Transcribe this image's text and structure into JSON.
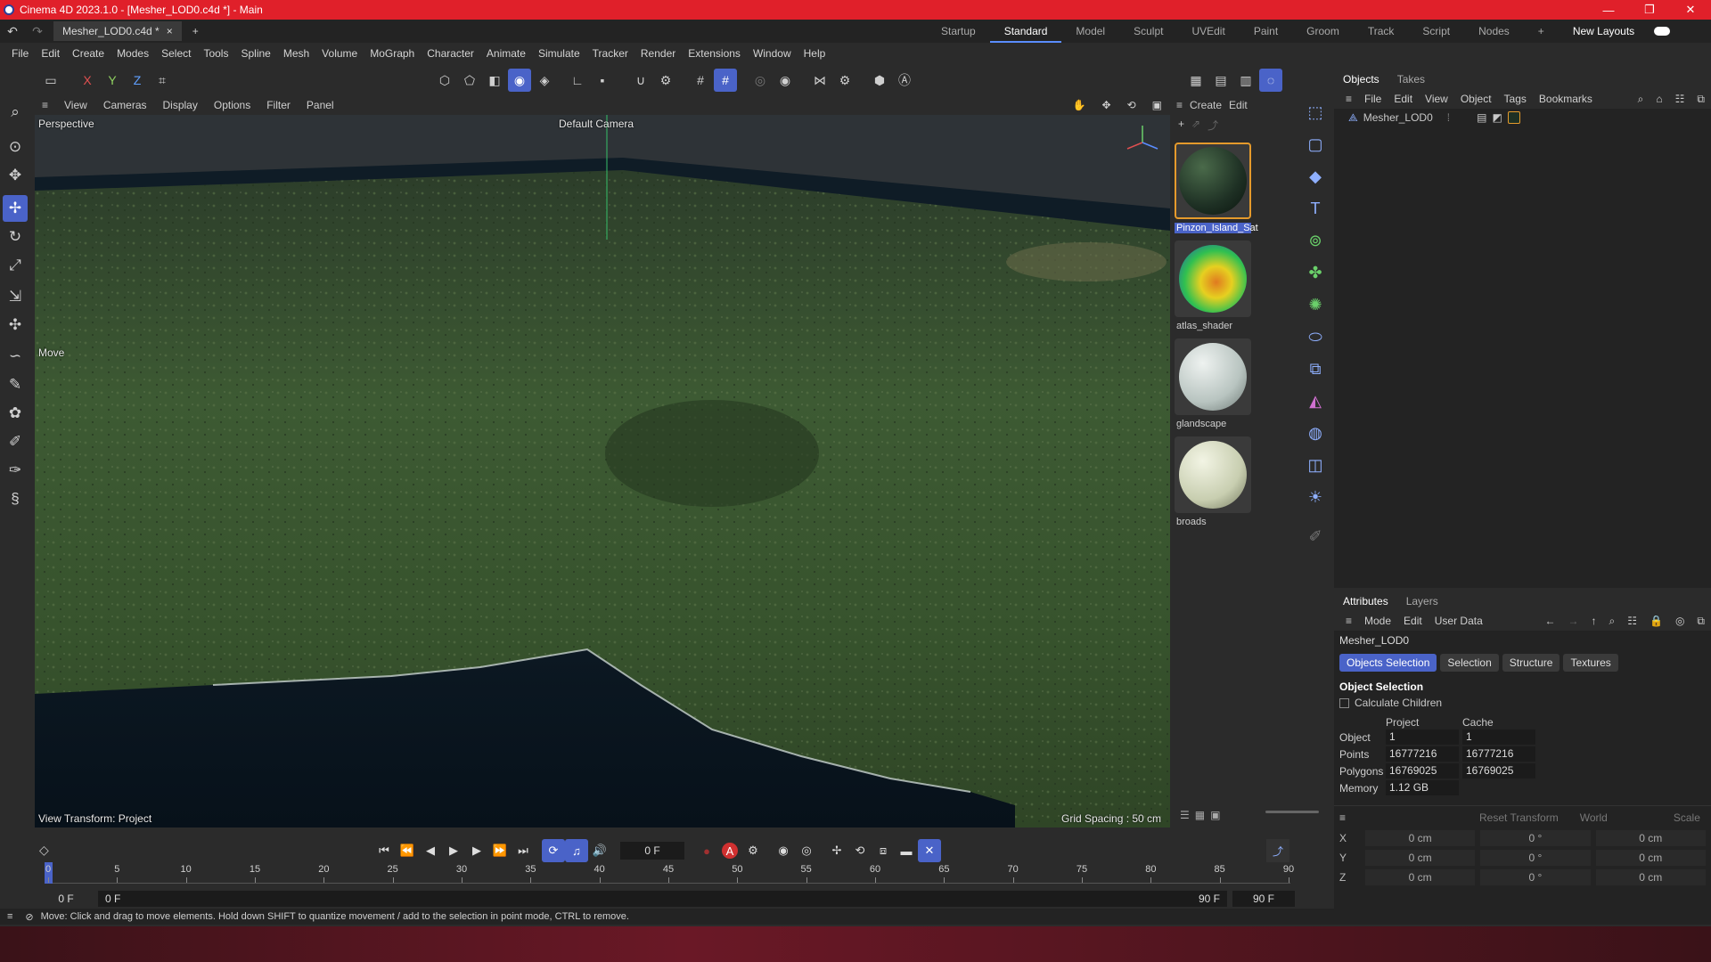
{
  "titlebar": {
    "title": "Cinema 4D 2023.1.0 - [Mesher_LOD0.c4d *] - Main",
    "min": "—",
    "max": "❐",
    "close": "✕"
  },
  "tabbar": {
    "doc_tab": "Mesher_LOD0.c4d *",
    "doc_close": "×",
    "add_tab": "+",
    "layouts": [
      "Startup",
      "Standard",
      "Model",
      "Sculpt",
      "UVEdit",
      "Paint",
      "Groom",
      "Track",
      "Script",
      "Nodes"
    ],
    "add_layout": "+",
    "new_layouts": "New Layouts"
  },
  "menubar": [
    "File",
    "Edit",
    "Create",
    "Modes",
    "Select",
    "Tools",
    "Spline",
    "Mesh",
    "Volume",
    "MoGraph",
    "Character",
    "Animate",
    "Simulate",
    "Tracker",
    "Render",
    "Extensions",
    "Window",
    "Help"
  ],
  "toolbar": {
    "x_label": "X",
    "y_label": "Y",
    "z_label": "Z"
  },
  "viewport_menu": [
    "View",
    "Cameras",
    "Display",
    "Options",
    "Filter",
    "Panel"
  ],
  "viewport": {
    "name": "Perspective",
    "camera": "Default Camera",
    "tool_label": "Move",
    "view_transform": "View Transform: Project",
    "grid_spacing": "Grid Spacing : 50 cm"
  },
  "material_menu": [
    "Create",
    "Edit"
  ],
  "materials": [
    {
      "name": "Pinzon_Island_Sat",
      "selected": true
    },
    {
      "name": "atlas_shader",
      "selected": false
    },
    {
      "name": "glandscape",
      "selected": false
    },
    {
      "name": "broads",
      "selected": false
    }
  ],
  "objects_panel": {
    "tabs": [
      "Objects",
      "Takes"
    ],
    "menu": [
      "File",
      "Edit",
      "View",
      "Object",
      "Tags",
      "Bookmarks"
    ],
    "item": "Mesher_LOD0"
  },
  "attributes_panel": {
    "tabs": [
      "Attributes",
      "Layers"
    ],
    "menu": [
      "Mode",
      "Edit",
      "User Data"
    ],
    "object_name": "Mesher_LOD0",
    "subtabs": [
      "Objects Selection",
      "Selection",
      "Structure",
      "Textures"
    ],
    "section_title": "Object Selection",
    "checkbox_label": "Calculate Children",
    "col_project": "Project",
    "col_cache": "Cache",
    "stats": [
      {
        "label": "Object",
        "project": "1",
        "cache": "1"
      },
      {
        "label": "Points",
        "project": "16777216",
        "cache": "16777216"
      },
      {
        "label": "Polygons",
        "project": "16769025",
        "cache": "16769025"
      },
      {
        "label": "Memory",
        "project": "1.12 GB",
        "cache": ""
      }
    ],
    "reset_transform": "Reset Transform",
    "world": "World",
    "scale": "Scale",
    "coords": [
      {
        "axis": "X",
        "pos": "0 cm",
        "rot": "0 °",
        "size": "0 cm"
      },
      {
        "axis": "Y",
        "pos": "0 cm",
        "rot": "0 °",
        "size": "0 cm"
      },
      {
        "axis": "Z",
        "pos": "0 cm",
        "rot": "0 °",
        "size": "0 cm"
      }
    ]
  },
  "timeline": {
    "current_frame": "0 F",
    "ruler_labels": [
      "0",
      "5",
      "10",
      "15",
      "20",
      "25",
      "30",
      "35",
      "40",
      "45",
      "50",
      "55",
      "60",
      "65",
      "70",
      "75",
      "80",
      "85",
      "90"
    ],
    "range_start": "0 F",
    "range_start2": "0 F",
    "range_end": "90 F",
    "range_end2": "90 F",
    "autokey": "A"
  },
  "statusbar": {
    "text": "Move: Click and drag to move elements. Hold down SHIFT to quantize movement / add to the selection in point mode, CTRL to remove."
  },
  "colors": {
    "titlebar": "#e0202a",
    "accent": "#4a63c8",
    "selection": "#e59a2c"
  }
}
